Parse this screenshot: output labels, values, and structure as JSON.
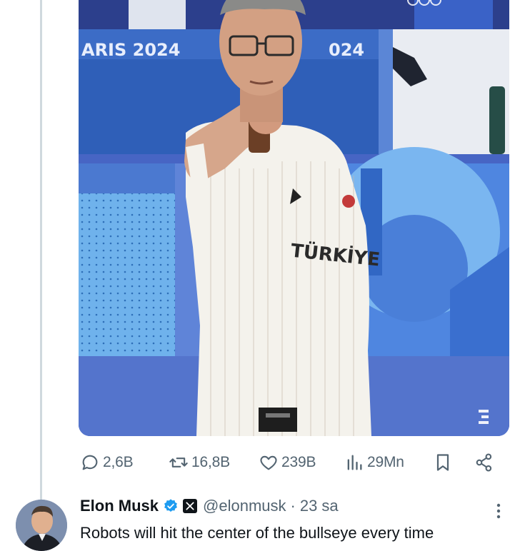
{
  "media": {
    "backdrop_text_left": "ARIS 2024",
    "backdrop_text_right": "024",
    "shirt_text": "TÜRKİYE"
  },
  "actions": {
    "reply_count": "2,6B",
    "retweet_count": "16,8B",
    "like_count": "239B",
    "view_count": "29Mn"
  },
  "reply": {
    "display_name": "Elon Musk",
    "handle": "@elonmusk",
    "separator": "·",
    "time": "23 sa",
    "text": "Robots will hit the center of the bullseye every time"
  },
  "colors": {
    "brand_blue": "#1d9bf0",
    "muted": "#536471",
    "thread_line": "#cfd9de"
  },
  "icons": [
    "reply-icon",
    "retweet-icon",
    "like-icon",
    "views-icon",
    "bookmark-icon",
    "share-icon",
    "verified-icon",
    "x-badge-icon",
    "more-icon"
  ]
}
